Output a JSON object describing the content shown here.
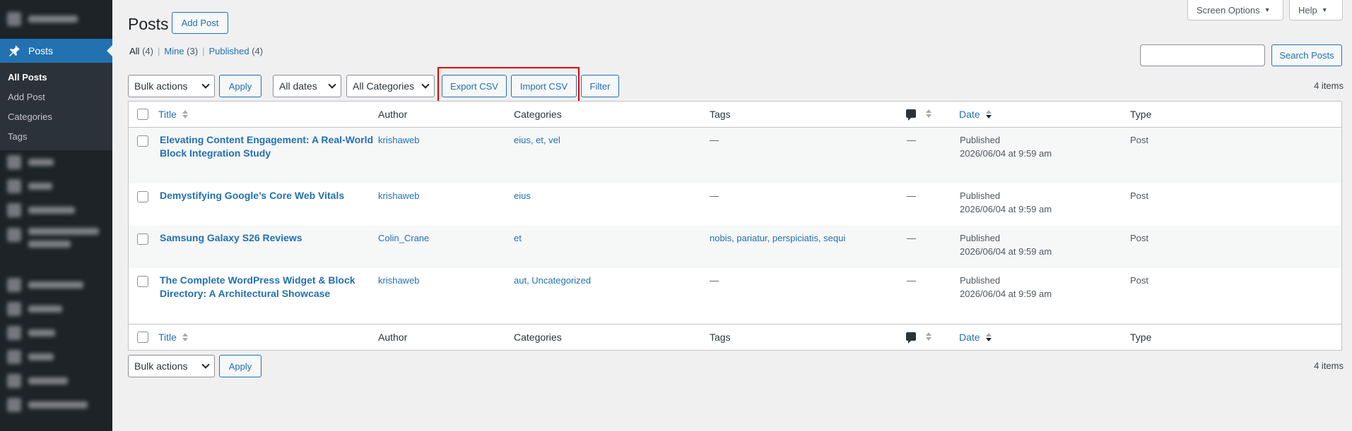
{
  "sidebar": {
    "current": "Posts",
    "submenu": [
      "All Posts",
      "Add Post",
      "Categories",
      "Tags"
    ]
  },
  "header": {
    "title": "Posts",
    "add_new": "Add Post",
    "screen_options": "Screen Options",
    "help": "Help"
  },
  "views": {
    "all": "All",
    "all_count": "(4)",
    "mine": "Mine",
    "mine_count": "(3)",
    "published": "Published",
    "published_count": "(4)",
    "sep": "|"
  },
  "search": {
    "button": "Search Posts",
    "placeholder": ""
  },
  "toolbar": {
    "bulk_actions": "Bulk actions",
    "apply": "Apply",
    "all_dates": "All dates",
    "all_categories": "All Categories",
    "export_csv": "Export CSV",
    "import_csv": "Import CSV",
    "filter": "Filter",
    "items_count": "4 items"
  },
  "table": {
    "columns": {
      "title": "Title",
      "author": "Author",
      "categories": "Categories",
      "tags": "Tags",
      "date": "Date",
      "type": "Type"
    },
    "rows": [
      {
        "title_line1": "Elevating Content Engagement: A Real-World",
        "title_line2": "Block Integration Study",
        "author": "krishaweb",
        "categories": "eius, et, vel",
        "tags": "—",
        "comments": "—",
        "status": "Published",
        "date": "2026/06/04 at 9:59 am",
        "type": "Post"
      },
      {
        "title_line1": "Demystifying Google’s Core Web Vitals",
        "title_line2": "",
        "author": "krishaweb",
        "categories": "eius",
        "tags": "—",
        "comments": "—",
        "status": "Published",
        "date": "2026/06/04 at 9:59 am",
        "type": "Post"
      },
      {
        "title_line1": "Samsung Galaxy S26 Reviews",
        "title_line2": "",
        "author": "Colin_Crane",
        "categories": "et",
        "tags": "nobis, pariatur, perspiciatis, sequi",
        "comments": "—",
        "status": "Published",
        "date": "2026/06/04 at 9:59 am",
        "type": "Post"
      },
      {
        "title_line1": "The Complete WordPress Widget & Block",
        "title_line2": "Directory: A Architectural Showcase",
        "author": "krishaweb",
        "categories": "aut, Uncategorized",
        "tags": "—",
        "comments": "—",
        "status": "Published",
        "date": "2026/06/04 at 9:59 am",
        "type": "Post"
      }
    ]
  },
  "colors": {
    "accent": "#2271b1",
    "sidebar_bg": "#1d2327",
    "highlight": "#e00000"
  }
}
